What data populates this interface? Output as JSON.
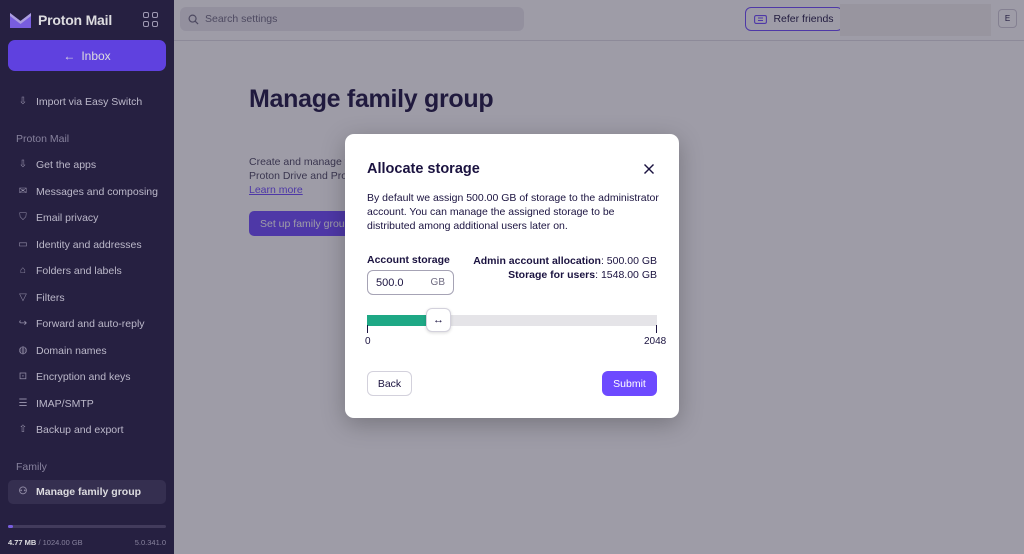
{
  "brand": {
    "name": "Proton Mail"
  },
  "sidebar": {
    "inbox_label": "Inbox",
    "import_label": "Import via Easy Switch",
    "section_mail": "Proton Mail",
    "mail_items": [
      {
        "label": "Get the apps",
        "icon": "download-icon"
      },
      {
        "label": "Messages and composing",
        "icon": "envelope-icon"
      },
      {
        "label": "Email privacy",
        "icon": "shield-icon"
      },
      {
        "label": "Identity and addresses",
        "icon": "id-card-icon"
      },
      {
        "label": "Folders and labels",
        "icon": "tag-icon"
      },
      {
        "label": "Filters",
        "icon": "filter-icon"
      },
      {
        "label": "Forward and auto-reply",
        "icon": "forward-icon"
      },
      {
        "label": "Domain names",
        "icon": "globe-icon"
      },
      {
        "label": "Encryption and keys",
        "icon": "lock-icon"
      },
      {
        "label": "IMAP/SMTP",
        "icon": "server-icon"
      },
      {
        "label": "Backup and export",
        "icon": "export-icon"
      }
    ],
    "section_family": "Family",
    "family_item": {
      "label": "Manage family group",
      "icon": "users-icon"
    },
    "storage": {
      "used": "4.77 MB",
      "sep": " / ",
      "total": "1024.00 GB",
      "fraction": 0.03
    },
    "version": "5.0.341.0"
  },
  "topbar": {
    "search_placeholder": "Search settings",
    "refer_label": "Refer friends",
    "avatar_initial": "E"
  },
  "main": {
    "title": "Manage family group",
    "desc_line1": "Create and manage f",
    "desc_line2": "Proton Drive and Pro",
    "learn_more": "Learn more",
    "setup_button": "Set up family grou"
  },
  "modal": {
    "title": "Allocate storage",
    "body": "By default we assign 500.00 GB of storage to the administrator account. You can manage the assigned storage to be distributed among additional users later on.",
    "account_storage_label": "Account storage",
    "account_storage_value": "500.0",
    "account_storage_unit": "GB",
    "admin_alloc_label": "Admin account allocation",
    "admin_alloc_value": ": 500.00 GB",
    "users_storage_label": "Storage for users",
    "users_storage_value": ": 1548.00 GB",
    "slider": {
      "min": 0,
      "max": 2048,
      "value": 500,
      "min_label": "0",
      "max_label": "2048",
      "handle_glyph": "↔",
      "fill_color": "#1ea885"
    },
    "back_label": "Back",
    "submit_label": "Submit"
  },
  "colors": {
    "accent": "#6d4aff",
    "sidebar_bg": "#2a2446"
  }
}
